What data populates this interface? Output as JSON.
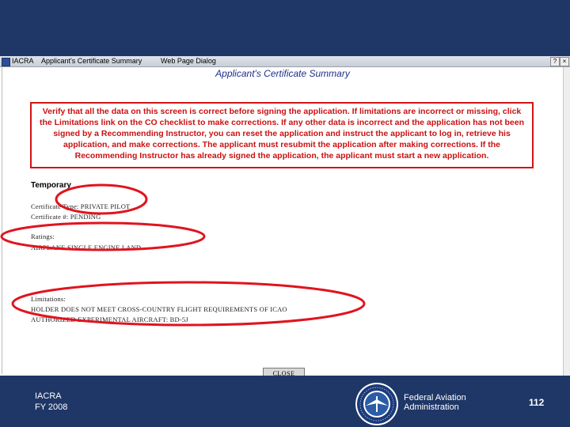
{
  "window": {
    "app": "IACRA",
    "title": "Applicant's Certificate Summary",
    "dialog": "Web Page Dialog",
    "help_label": "?",
    "close_label": "×"
  },
  "page": {
    "heading": "Applicant's Certificate Summary",
    "warning": "Verify that all the data on this screen is correct before signing the application. If limitations are incorrect or missing, click the Limitations link on the CO checklist to make corrections. If any other data is incorrect and the application has not been signed by a Recommending Instructor, you can reset the application and instruct the applicant to log in, retrieve his application, and make corrections. The applicant must resubmit the application after making corrections. If the Recommending Instructor has already signed the application, the applicant must start a new application.",
    "section": "Temporary",
    "certificate_type": "Certificate Type: PRIVATE PILOT",
    "certificate_status": "Certificate #: PENDING",
    "ratings_label": "Ratings:",
    "ratings_value": "AIRPLANE SINGLE ENGINE LAND",
    "limitations_label": "Limitations:",
    "limitation_1": "HOLDER DOES NOT MEET CROSS-COUNTRY FLIGHT REQUIREMENTS OF ICAO",
    "limitation_2": "AUTHORIZED EXPERIMENTAL AIRCRAFT: BD-5J",
    "close_button": "CLOSE"
  },
  "footer": {
    "org_line1": "IACRA",
    "org_line2": "FY 2008",
    "agency_line1": "Federal Aviation",
    "agency_line2": "Administration",
    "page_number": "112"
  },
  "colors": {
    "slide_background": "#1f3767",
    "warning_red": "#d21414",
    "heading_blue": "#1d2f8a",
    "annotation_red": "#e0141e"
  }
}
